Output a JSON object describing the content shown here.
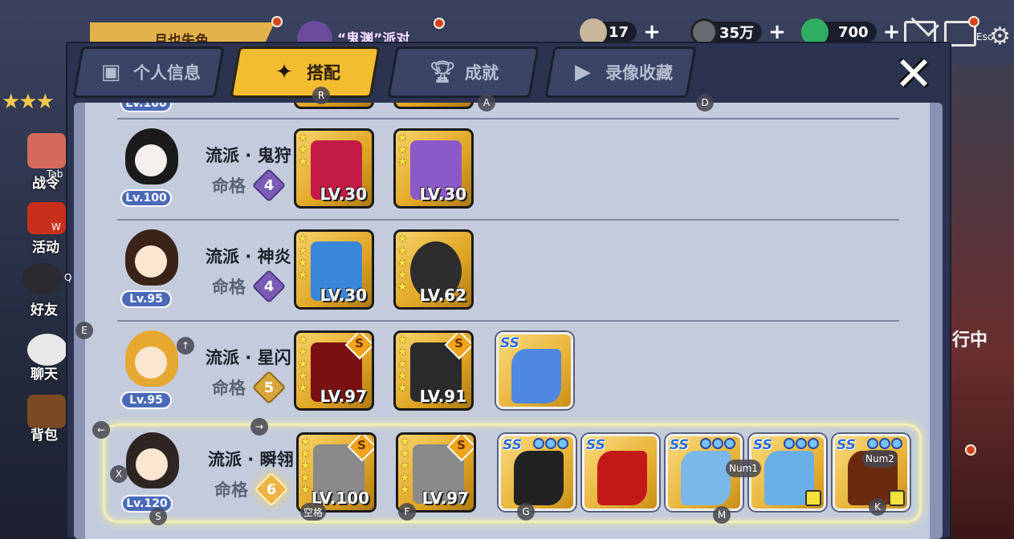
{
  "background": {
    "banner_text": "月也失色",
    "event_text": "“鬼渊”派对",
    "side_menu": [
      {
        "label": "战令",
        "icon": "battle-pass-icon"
      },
      {
        "label": "活动",
        "icon": "torii-gate-icon"
      },
      {
        "label": "好友",
        "icon": "ninja-friend-icon"
      },
      {
        "label": "聊天",
        "icon": "chat-bubble-icon"
      },
      {
        "label": "背包",
        "icon": "backpack-icon"
      }
    ],
    "right_text": "行中"
  },
  "resources": [
    {
      "icon": "rice-ball-icon",
      "value": "17",
      "color": "#c9b79a"
    },
    {
      "icon": "coin-icon",
      "value": "35万",
      "color": "#666a70"
    },
    {
      "icon": "jade-icon",
      "value": "700",
      "color": "#2fae62"
    }
  ],
  "tabs": [
    {
      "label": "个人信息",
      "icon": "id-card-icon",
      "active": false
    },
    {
      "label": "搭配",
      "icon": "diamond-star-icon",
      "active": true
    },
    {
      "label": "成就",
      "icon": "trophy-icon",
      "active": false
    },
    {
      "label": "录像收藏",
      "icon": "play-icon",
      "active": false
    }
  ],
  "rows": [
    {
      "level": "Lv.100",
      "school": "流派 · 鬼狩",
      "fate_label": "命格",
      "fate": "4",
      "weapons": [
        {
          "level": "LV.30",
          "stars": 3,
          "grade": "",
          "color": "#c31b46"
        },
        {
          "level": "LV.30",
          "stars": 3,
          "grade": "",
          "color": "#8b59c8"
        }
      ],
      "accessories": []
    },
    {
      "level": "Lv.95",
      "school": "流派 · 神炎",
      "fate_label": "命格",
      "fate": "4",
      "weapons": [
        {
          "level": "LV.30",
          "stars": 4,
          "grade": "",
          "color": "#3a86d8"
        },
        {
          "level": "LV.62",
          "stars": 5,
          "grade": "",
          "color": "#2d2d2d"
        }
      ],
      "accessories": []
    },
    {
      "level": "Lv.95",
      "school": "流派 · 星闪",
      "fate_label": "命格",
      "fate": "5",
      "weapons": [
        {
          "level": "LV.97",
          "stars": 5,
          "grade": "S",
          "color": "#7a1010"
        },
        {
          "level": "LV.91",
          "stars": 5,
          "grade": "S",
          "color": "#2a2a2a"
        }
      ],
      "accessories": [
        {
          "grade": "SS",
          "orbs": 0,
          "color": "#4e88e2"
        }
      ]
    },
    {
      "level": "Lv.120",
      "school": "流派 · 瞬翎",
      "fate_label": "命格",
      "fate": "6",
      "weapons": [
        {
          "level": "LV.100",
          "stars": 5,
          "grade": "S",
          "color": "#8a8a8a"
        },
        {
          "level": "LV.97",
          "stars": 5,
          "grade": "S",
          "color": "#8a8a8a"
        }
      ],
      "accessories": [
        {
          "grade": "SS",
          "orbs": 3,
          "color": "#222222"
        },
        {
          "grade": "SS",
          "orbs": 0,
          "color": "#c21818"
        },
        {
          "grade": "SS",
          "orbs": 3,
          "color": "#7ab8ea"
        },
        {
          "grade": "SS",
          "orbs": 3,
          "color": "#6aaee6"
        },
        {
          "grade": "SS",
          "orbs": 3,
          "color": "#6a2a10"
        }
      ]
    }
  ],
  "partial_top_row": {
    "level": "Lv.100"
  },
  "key_hints": {
    "r": "R",
    "a": "A",
    "d": "D",
    "tab": "Tab",
    "w": "W",
    "q": "Q",
    "e": "E",
    "up": "↑",
    "left": "←",
    "right": "→",
    "x": "X",
    "s": "S",
    "space": "空格",
    "f": "F",
    "g": "G",
    "m": "M",
    "k": "K",
    "num1": "Num1",
    "num2": "Num2",
    "esc": "Esc"
  },
  "colors": {
    "tab_active": "#f3bd32",
    "panel": "#2b3350",
    "list_bg": "#c4cbdc",
    "level_badge": "#4a6ab8"
  }
}
